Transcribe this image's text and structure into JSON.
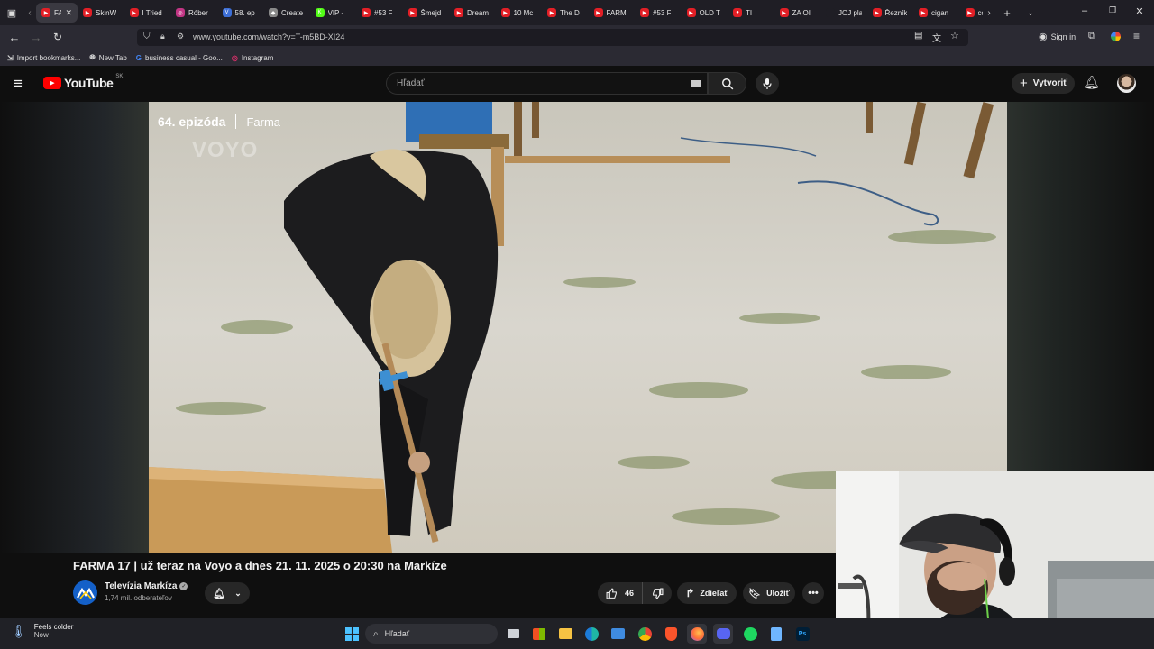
{
  "browser": {
    "tabs": [
      {
        "label": "FA",
        "fav": "▶",
        "color": "#e21f26",
        "active": true
      },
      {
        "label": "SkinW",
        "fav": "▶",
        "color": "#e21f26"
      },
      {
        "label": "I Tried",
        "fav": "▶",
        "color": "#e21f26"
      },
      {
        "label": "Róber",
        "fav": "◎",
        "color": "#c13584"
      },
      {
        "label": "58. ep",
        "fav": "V",
        "color": "#3c6ed6"
      },
      {
        "label": "Create",
        "fav": "◆",
        "color": "#8a8a8a"
      },
      {
        "label": "VIP -",
        "fav": "K",
        "color": "#53fc18"
      },
      {
        "label": "#53 F",
        "fav": "▶",
        "color": "#e21f26"
      },
      {
        "label": "Šmejd",
        "fav": "▶",
        "color": "#e21f26"
      },
      {
        "label": "Dream",
        "fav": "▶",
        "color": "#e21f26"
      },
      {
        "label": "10 Mc",
        "fav": "▶",
        "color": "#e21f26"
      },
      {
        "label": "The D",
        "fav": "▶",
        "color": "#e21f26"
      },
      {
        "label": "FARM",
        "fav": "▶",
        "color": "#e21f26"
      },
      {
        "label": "#53 F",
        "fav": "▶",
        "color": "#e21f26"
      },
      {
        "label": "OLD T",
        "fav": "▶",
        "color": "#e21f26"
      },
      {
        "label": "TI",
        "fav": "●",
        "color": "#e21f26"
      },
      {
        "label": "ZA OI",
        "fav": "▶",
        "color": "#e21f26"
      },
      {
        "label": "JOJ play",
        "fav": "",
        "color": "#1f1e25"
      },
      {
        "label": "Řezník",
        "fav": "▶",
        "color": "#e21f26"
      },
      {
        "label": "cigan",
        "fav": "▶",
        "color": "#e21f26"
      },
      {
        "label": "co",
        "fav": "▶",
        "color": "#e21f26"
      }
    ],
    "url": "www.youtube.com/watch?v=T-m5BD-XI24",
    "sign_in": "Sign in",
    "bookmarks": [
      {
        "label": "Import bookmarks...",
        "icon": "import-icon"
      },
      {
        "label": "New Tab",
        "icon": "globe-icon"
      },
      {
        "label": "business casual - Goo...",
        "icon": "google-icon"
      },
      {
        "label": "Instagram",
        "icon": "instagram-icon"
      }
    ]
  },
  "youtube": {
    "logo_text": "YouTube",
    "region": "SK",
    "search_placeholder": "Hľadať",
    "create_label": "Vytvoriť"
  },
  "video": {
    "episode": "64. epizóda",
    "show": "Farma",
    "watermark": "VOYO",
    "title": "FARMA 17 | už teraz na Voyo a dnes 21. 11. 2025 o 20:30 na Markíze",
    "channel_name": "Televízia Markíza",
    "subscribers": "1,74 mil. odberateľov",
    "likes": "46",
    "share_label": "Zdieľať",
    "save_label": "Uložiť"
  },
  "taskbar": {
    "weather_title": "Feels colder",
    "weather_sub": "Now",
    "search_placeholder": "Hľadať"
  }
}
